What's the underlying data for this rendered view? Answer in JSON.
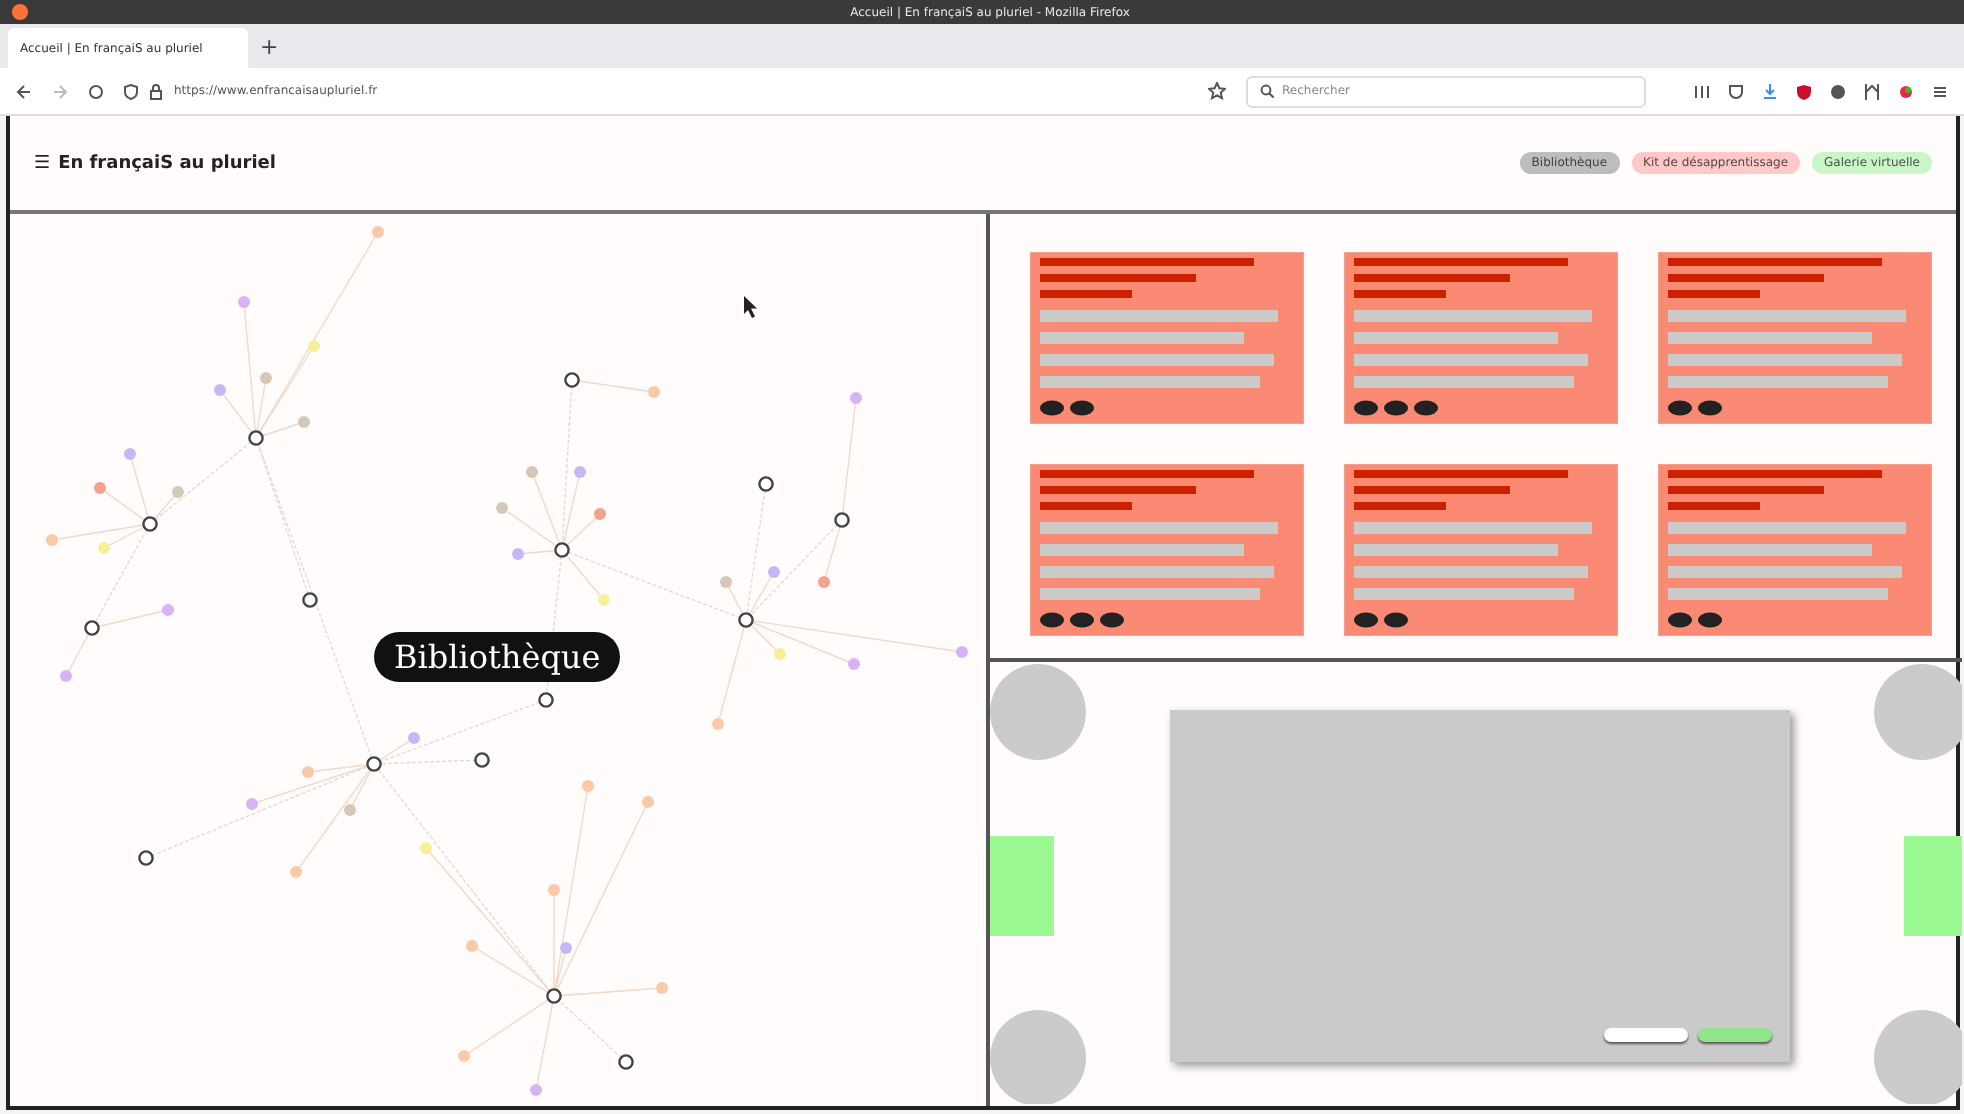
{
  "window": {
    "title": "Accueil | En françaiS au pluriel - Mozilla Firefox"
  },
  "tabs": [
    {
      "label": "Accueil | En françaiS au pluriel",
      "selected": true
    }
  ],
  "new_tab": {
    "glyph": "+"
  },
  "address_bar": {
    "value": "https://www.enfrancaisaupluriel.fr"
  },
  "search": {
    "placeholder": "Rechercher"
  },
  "site": {
    "menu_glyph": "☰",
    "title": "En françaiS au pluriel"
  },
  "nav": [
    {
      "label": "Bibliothèque",
      "color": "#bdbdbd"
    },
    {
      "label": "Kit de désapprentissage",
      "color": "#ffc9c9"
    },
    {
      "label": "Galerie virtuelle",
      "color": "#c9f5c9"
    }
  ],
  "graph": {
    "label": "Bibliothèque"
  }
}
